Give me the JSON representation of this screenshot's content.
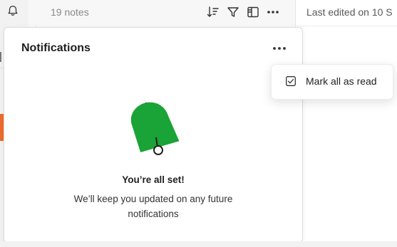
{
  "notes_list": {
    "count_label": "19 notes",
    "toolbar_icons": [
      "sort-icon",
      "filter-icon",
      "layout-icon",
      "more-icon"
    ]
  },
  "editor": {
    "last_edited": "Last edited on 10 S"
  },
  "notifications": {
    "title": "Notifications",
    "more_icon": "more-icon",
    "empty_title": "You’re all set!",
    "empty_message": "We’ll keep you updated on any future notifications"
  },
  "dropdown": {
    "items": [
      {
        "label": "Mark all as read",
        "icon": "checkbox-icon"
      }
    ]
  },
  "colors": {
    "accent_green": "#1aa336",
    "orange": "#f06b2a"
  }
}
